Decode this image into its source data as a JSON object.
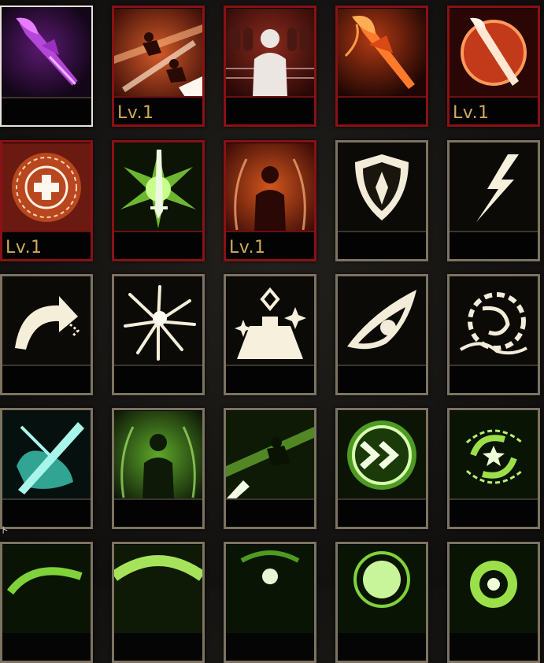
{
  "grid": {
    "row0": [
      {
        "level": ""
      },
      {
        "level": "Lv.1"
      },
      {
        "level": ""
      },
      {
        "level": ""
      },
      {
        "level": "Lv.1"
      }
    ],
    "row1": [
      {
        "level": "Lv.1"
      },
      {
        "level": ""
      },
      {
        "level": "Lv.1"
      },
      {
        "level": ""
      },
      {
        "level": ""
      }
    ]
  },
  "edge_mark": "ト"
}
